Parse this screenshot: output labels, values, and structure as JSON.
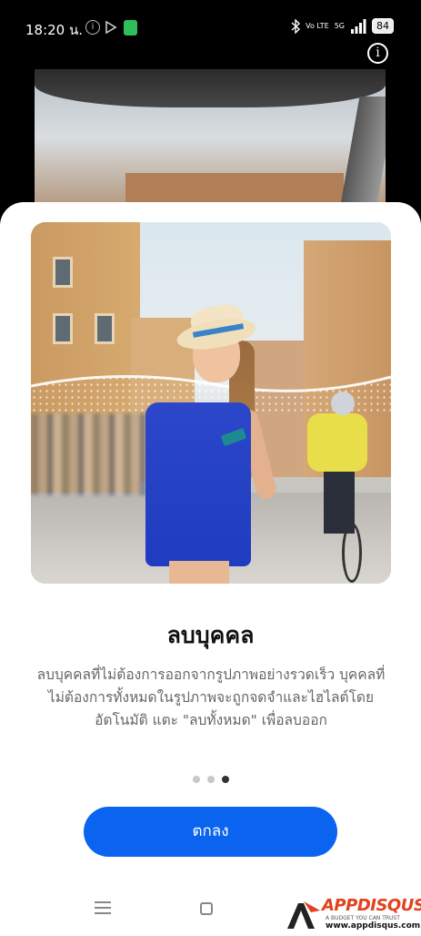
{
  "status_bar": {
    "time": "18:20 น.",
    "network": "5G",
    "volte": "Vo LTE",
    "battery": "84"
  },
  "feature": {
    "title": "ลบบุคคล",
    "description": "ลบบุคคลที่ไม่ต้องการออกจากรูปภาพอย่างรวดเร็ว บุคคลที่ไม่ต้องการทั้งหมดในรูปภาพจะถูกจดจำและไฮไลต์โดยอัตโนมัติ แตะ \"ลบทั้งหมด\" เพื่อลบออก"
  },
  "pager": {
    "total": 3,
    "active_index": 2
  },
  "ok_button": {
    "label": "ตกลง"
  },
  "watermark": {
    "brand": "APPDISQUS",
    "tagline": "A BUDGET YOU CAN TRUST",
    "url": "www.appdisqus.com"
  },
  "colors": {
    "primary_button": "#0a64f0",
    "sheet_bg": "#ffffff"
  }
}
